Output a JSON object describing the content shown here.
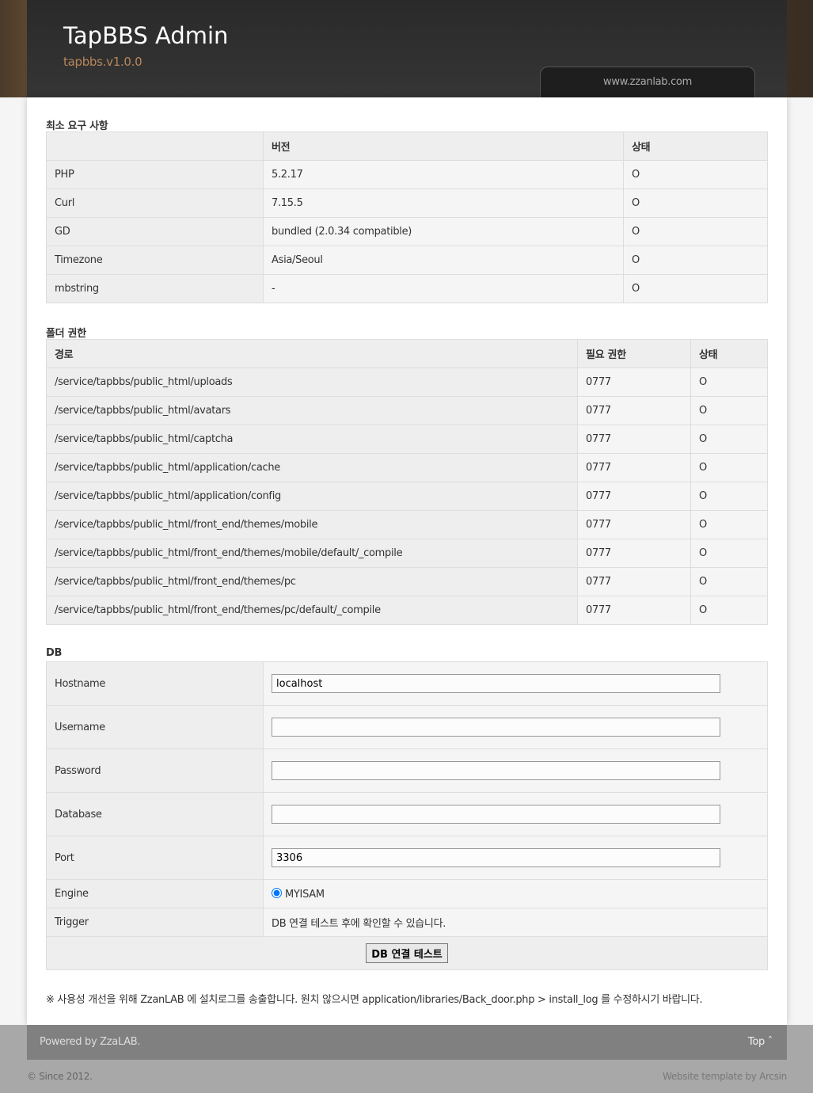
{
  "header": {
    "title": "TapBBS Admin",
    "version": "tapbbs.v1.0.0",
    "site_link": "www.zzanlab.com"
  },
  "requirements": {
    "title": "최소 요구 사항",
    "columns": [
      "",
      "버전",
      "상태"
    ],
    "rows": [
      [
        "PHP",
        "5.2.17",
        "O"
      ],
      [
        "Curl",
        "7.15.5",
        "O"
      ],
      [
        "GD",
        "bundled (2.0.34 compatible)",
        "O"
      ],
      [
        "Timezone",
        "Asia/Seoul",
        "O"
      ],
      [
        "mbstring",
        "-",
        "O"
      ]
    ]
  },
  "folders": {
    "title": "폴더 권한",
    "columns": [
      "경로",
      "필요 권한",
      "상태"
    ],
    "rows": [
      [
        "/service/tapbbs/public_html/uploads",
        "0777",
        "O"
      ],
      [
        "/service/tapbbs/public_html/avatars",
        "0777",
        "O"
      ],
      [
        "/service/tapbbs/public_html/captcha",
        "0777",
        "O"
      ],
      [
        "/service/tapbbs/public_html/application/cache",
        "0777",
        "O"
      ],
      [
        "/service/tapbbs/public_html/application/config",
        "0777",
        "O"
      ],
      [
        "/service/tapbbs/public_html/front_end/themes/mobile",
        "0777",
        "O"
      ],
      [
        "/service/tapbbs/public_html/front_end/themes/mobile/default/_compile",
        "0777",
        "O"
      ],
      [
        "/service/tapbbs/public_html/front_end/themes/pc",
        "0777",
        "O"
      ],
      [
        "/service/tapbbs/public_html/front_end/themes/pc/default/_compile",
        "0777",
        "O"
      ]
    ]
  },
  "db": {
    "title": "DB",
    "fields": [
      {
        "label": "Hostname",
        "value": "localhost"
      },
      {
        "label": "Username",
        "value": ""
      },
      {
        "label": "Password",
        "value": ""
      },
      {
        "label": "Database",
        "value": ""
      },
      {
        "label": "Port",
        "value": "3306"
      }
    ],
    "engine_label": "Engine",
    "engine_option": "MYISAM",
    "trigger_label": "Trigger",
    "trigger_text": "DB 연결 테스트 후에 확인할 수 있습니다.",
    "test_button": "DB 연결 테스트"
  },
  "note": "※ 사용성 개선을 위해 ZzanLAB 에 설치로그를 송출합니다. 원치 않으시면 application/libraries/Back_door.php > install_log 를 수정하시기 바랍니다.",
  "footer": {
    "powered": "Powered by ZzaLAB.",
    "top": "Top ˆ",
    "copyright": "© Since 2012.",
    "template": "Website template by Arcsin"
  }
}
